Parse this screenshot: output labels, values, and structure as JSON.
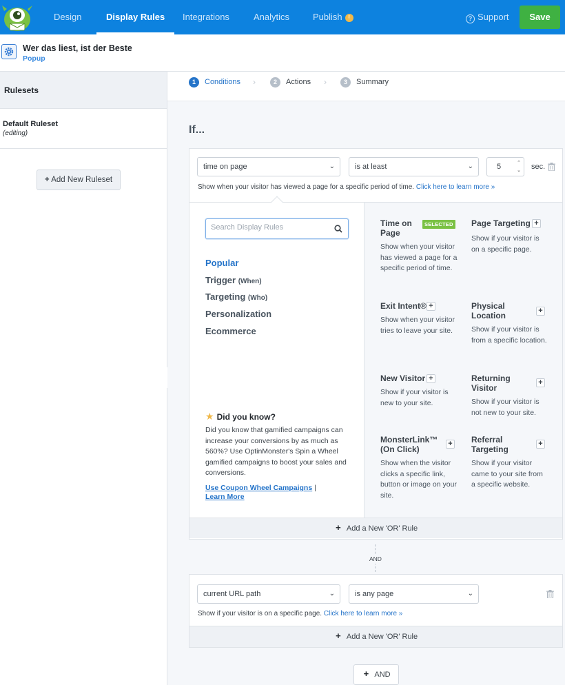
{
  "nav": {
    "items": [
      {
        "label": "Design",
        "active": false
      },
      {
        "label": "Display Rules",
        "active": true
      },
      {
        "label": "Integrations",
        "active": false
      },
      {
        "label": "Analytics",
        "active": false
      },
      {
        "label": "Publish",
        "active": false
      }
    ],
    "publish_badge": "!",
    "support_label": "Support",
    "save_label": "Save",
    "color_primary": "#0d82df",
    "color_save": "#3fb142"
  },
  "campaign": {
    "title": "Wer das liest, ist der Beste",
    "type": "Popup"
  },
  "sidebar": {
    "title": "Rulesets",
    "rulesets": [
      {
        "name": "Default Ruleset",
        "state": "(editing)"
      }
    ],
    "add_button": "Add New Ruleset"
  },
  "steps": [
    {
      "num": "1",
      "label": "Conditions",
      "active": true
    },
    {
      "num": "2",
      "label": "Actions",
      "active": false
    },
    {
      "num": "3",
      "label": "Summary",
      "active": false
    }
  ],
  "if_label": "If...",
  "rule1": {
    "condition": "time on page",
    "operator": "is at least",
    "value": "5",
    "unit": "sec.",
    "description": "Show when your visitor has viewed a page for a specific period of time.",
    "learn_more": "Click here to learn more »"
  },
  "picker": {
    "search_placeholder": "Search Display Rules",
    "categories": [
      {
        "label": "Popular",
        "sub": "",
        "active": true
      },
      {
        "label": "Trigger",
        "sub": "(When)",
        "active": false
      },
      {
        "label": "Targeting",
        "sub": "(Who)",
        "active": false
      },
      {
        "label": "Personalization",
        "sub": "",
        "active": false
      },
      {
        "label": "Ecommerce",
        "sub": "",
        "active": false
      }
    ],
    "did_you_know": {
      "title": "Did you know?",
      "text": "Did you know that gamified campaigns can increase your conversions by as much as 560%? Use OptinMonster's Spin a Wheel gamified campaigns to boost your sales and conversions.",
      "link1": "Use Coupon Wheel Campaigns",
      "separator": "|",
      "link2": "Learn More"
    },
    "selected_label": "SELECTED",
    "options": [
      {
        "title": "Time on Page",
        "desc": "Show when your visitor has viewed a page for a specific period of time.",
        "selected": true
      },
      {
        "title": "Page Targeting",
        "desc": "Show if your visitor is on a specific page.",
        "selected": false
      },
      {
        "title": "Exit Intent®",
        "desc": "Show when your visitor tries to leave your site.",
        "selected": false
      },
      {
        "title": "Physical Location",
        "desc": "Show if your visitor is from a specific location.",
        "selected": false
      },
      {
        "title": "New Visitor",
        "desc": "Show if your visitor is new to your site.",
        "selected": false
      },
      {
        "title": "Returning Visitor",
        "desc": "Show if your visitor is not new to your site.",
        "selected": false
      },
      {
        "title": "MonsterLink™ (On Click)",
        "desc": "Show when the visitor clicks a specific link, button or image on your site.",
        "selected": false
      },
      {
        "title": "Referral Targeting",
        "desc": "Show if your visitor came to your site from a specific website.",
        "selected": false
      }
    ]
  },
  "or_rule_label": "Add a New 'OR' Rule",
  "and_label": "AND",
  "rule2": {
    "condition": "current URL path",
    "operator": "is any page",
    "description": "Show if your visitor is on a specific page.",
    "learn_more": "Click here to learn more »"
  },
  "and_button": "AND"
}
